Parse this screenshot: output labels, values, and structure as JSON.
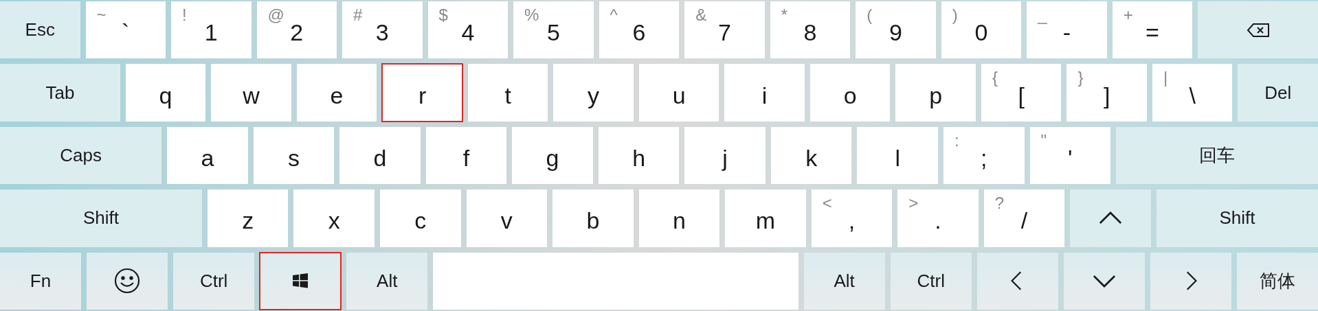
{
  "rows": [
    {
      "keys": [
        {
          "kind": "function",
          "label": "Esc",
          "selected": false
        },
        {
          "kind": "char",
          "shift": "~",
          "label": "`",
          "selected": false
        },
        {
          "kind": "char",
          "shift": "!",
          "label": "1",
          "selected": false
        },
        {
          "kind": "char",
          "shift": "@",
          "label": "2",
          "selected": false
        },
        {
          "kind": "char",
          "shift": "#",
          "label": "3",
          "selected": false
        },
        {
          "kind": "char",
          "shift": "$",
          "label": "4",
          "selected": false
        },
        {
          "kind": "char",
          "shift": "%",
          "label": "5",
          "selected": false
        },
        {
          "kind": "char",
          "shift": "^",
          "label": "6",
          "selected": false
        },
        {
          "kind": "char",
          "shift": "&",
          "label": "7",
          "selected": false
        },
        {
          "kind": "char",
          "shift": "*",
          "label": "8",
          "selected": false
        },
        {
          "kind": "char",
          "shift": "(",
          "label": "9",
          "selected": false
        },
        {
          "kind": "char",
          "shift": ")",
          "label": "0",
          "selected": false
        },
        {
          "kind": "char",
          "shift": "_",
          "label": "-",
          "selected": false
        },
        {
          "kind": "char",
          "shift": "+",
          "label": "=",
          "selected": false
        },
        {
          "kind": "backspace",
          "selected": false
        }
      ]
    },
    {
      "keys": [
        {
          "kind": "function",
          "label": "Tab",
          "selected": false
        },
        {
          "kind": "char",
          "label": "q",
          "selected": false
        },
        {
          "kind": "char",
          "label": "w",
          "selected": false
        },
        {
          "kind": "char",
          "label": "e",
          "selected": false
        },
        {
          "kind": "char",
          "label": "r",
          "selected": true
        },
        {
          "kind": "char",
          "label": "t",
          "selected": false
        },
        {
          "kind": "char",
          "label": "y",
          "selected": false
        },
        {
          "kind": "char",
          "label": "u",
          "selected": false
        },
        {
          "kind": "char",
          "label": "i",
          "selected": false
        },
        {
          "kind": "char",
          "label": "o",
          "selected": false
        },
        {
          "kind": "char",
          "label": "p",
          "selected": false
        },
        {
          "kind": "char",
          "shift": "{",
          "label": "[",
          "selected": false
        },
        {
          "kind": "char",
          "shift": "}",
          "label": "]",
          "selected": false
        },
        {
          "kind": "char",
          "shift": "|",
          "label": "\\",
          "selected": false
        },
        {
          "kind": "function",
          "label": "Del",
          "selected": false
        }
      ]
    },
    {
      "keys": [
        {
          "kind": "function",
          "label": "Caps",
          "selected": false
        },
        {
          "kind": "char",
          "label": "a",
          "selected": false
        },
        {
          "kind": "char",
          "label": "s",
          "selected": false
        },
        {
          "kind": "char",
          "label": "d",
          "selected": false
        },
        {
          "kind": "char",
          "label": "f",
          "selected": false
        },
        {
          "kind": "char",
          "label": "g",
          "selected": false
        },
        {
          "kind": "char",
          "label": "h",
          "selected": false
        },
        {
          "kind": "char",
          "label": "j",
          "selected": false
        },
        {
          "kind": "char",
          "label": "k",
          "selected": false
        },
        {
          "kind": "char",
          "label": "l",
          "selected": false
        },
        {
          "kind": "char",
          "shift": ":",
          "label": ";",
          "selected": false
        },
        {
          "kind": "char",
          "shift": "\"",
          "label": "'",
          "selected": false
        },
        {
          "kind": "function",
          "label": "回车",
          "selected": false
        }
      ]
    },
    {
      "keys": [
        {
          "kind": "function",
          "label": "Shift",
          "selected": false
        },
        {
          "kind": "char",
          "label": "z",
          "selected": false
        },
        {
          "kind": "char",
          "label": "x",
          "selected": false
        },
        {
          "kind": "char",
          "label": "c",
          "selected": false
        },
        {
          "kind": "char",
          "label": "v",
          "selected": false
        },
        {
          "kind": "char",
          "label": "b",
          "selected": false
        },
        {
          "kind": "char",
          "label": "n",
          "selected": false
        },
        {
          "kind": "char",
          "label": "m",
          "selected": false
        },
        {
          "kind": "char",
          "shift": "<",
          "label": ",",
          "selected": false
        },
        {
          "kind": "char",
          "shift": ">",
          "label": ".",
          "selected": false
        },
        {
          "kind": "char",
          "shift": "?",
          "label": "/",
          "selected": false
        },
        {
          "kind": "up",
          "selected": false
        },
        {
          "kind": "function",
          "label": "Shift",
          "selected": false
        }
      ]
    },
    {
      "keys": [
        {
          "kind": "function",
          "label": "Fn",
          "selected": false
        },
        {
          "kind": "emoji",
          "selected": false
        },
        {
          "kind": "function",
          "label": "Ctrl",
          "selected": false
        },
        {
          "kind": "windows",
          "selected": true
        },
        {
          "kind": "function",
          "label": "Alt",
          "selected": false
        },
        {
          "kind": "space",
          "selected": false
        },
        {
          "kind": "function",
          "label": "Alt",
          "selected": false
        },
        {
          "kind": "function",
          "label": "Ctrl",
          "selected": false
        },
        {
          "kind": "left",
          "selected": false
        },
        {
          "kind": "down",
          "selected": false
        },
        {
          "kind": "right",
          "selected": false
        },
        {
          "kind": "function",
          "label": "简体",
          "selected": false
        }
      ]
    }
  ]
}
